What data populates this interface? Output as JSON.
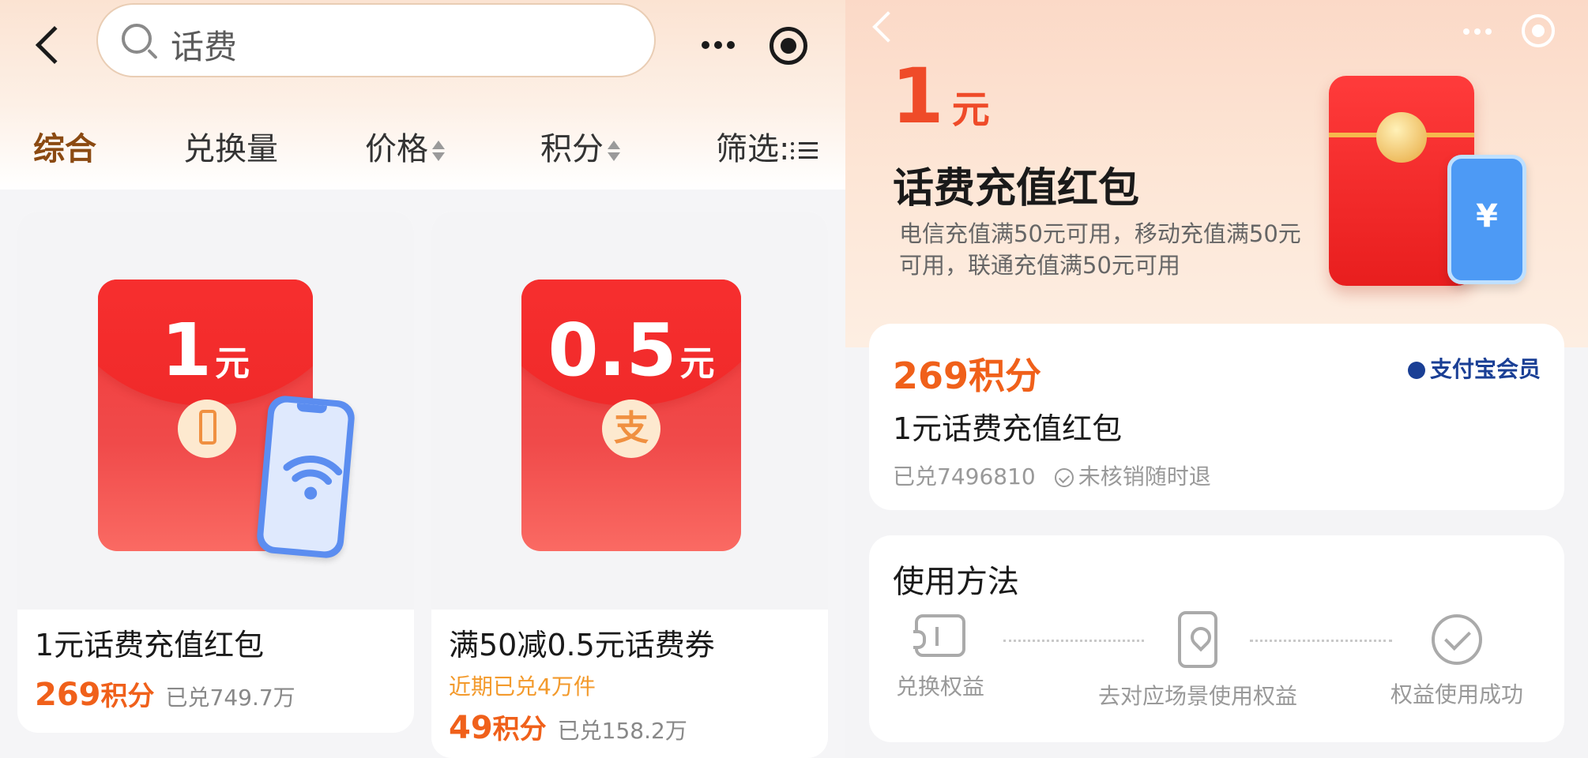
{
  "left": {
    "search": {
      "query": "话费"
    },
    "sort_tabs": [
      {
        "label": "综合",
        "active": true
      },
      {
        "label": "兑换量",
        "active": false
      },
      {
        "label": "价格",
        "active": false
      },
      {
        "label": "积分",
        "active": false
      },
      {
        "label": "筛选",
        "active": false
      }
    ],
    "products": [
      {
        "image_amount": "1",
        "image_unit": "元",
        "title": "1元话费充值红包",
        "points": "269",
        "points_unit": "积分",
        "redeemed": "已兑749.7万"
      },
      {
        "image_amount": "0.5",
        "image_unit": "元",
        "coin_char": "支",
        "title": "满50减0.5元话费券",
        "recent": "近期已兑4万件",
        "points": "49",
        "points_unit": "积分",
        "redeemed": "已兑158.2万"
      }
    ]
  },
  "right": {
    "hero": {
      "amount": "1",
      "unit": "元",
      "title": "话费充值红包",
      "description": "电信充值满50元可用，移动充值满50元可用，联通充值满50元可用",
      "phone_symbol": "¥"
    },
    "info": {
      "points": "269积分",
      "badge": "支付宝会员",
      "name": "1元话费充值红包",
      "redeemed": "已兑7496810",
      "refund_note": "未核销随时退"
    },
    "usage": {
      "heading": "使用方法",
      "steps": [
        {
          "label": "兑换权益",
          "icon": "ticket-icon"
        },
        {
          "label": "去对应场景使用权益",
          "icon": "phone-location-icon"
        },
        {
          "label": "权益使用成功",
          "icon": "check-circle-icon"
        }
      ]
    }
  },
  "colors": {
    "accent_orange": "#f0601a",
    "active_tab": "#8b4a12",
    "packet_red": "#f33a3a",
    "badge_blue": "#1a3f95"
  }
}
